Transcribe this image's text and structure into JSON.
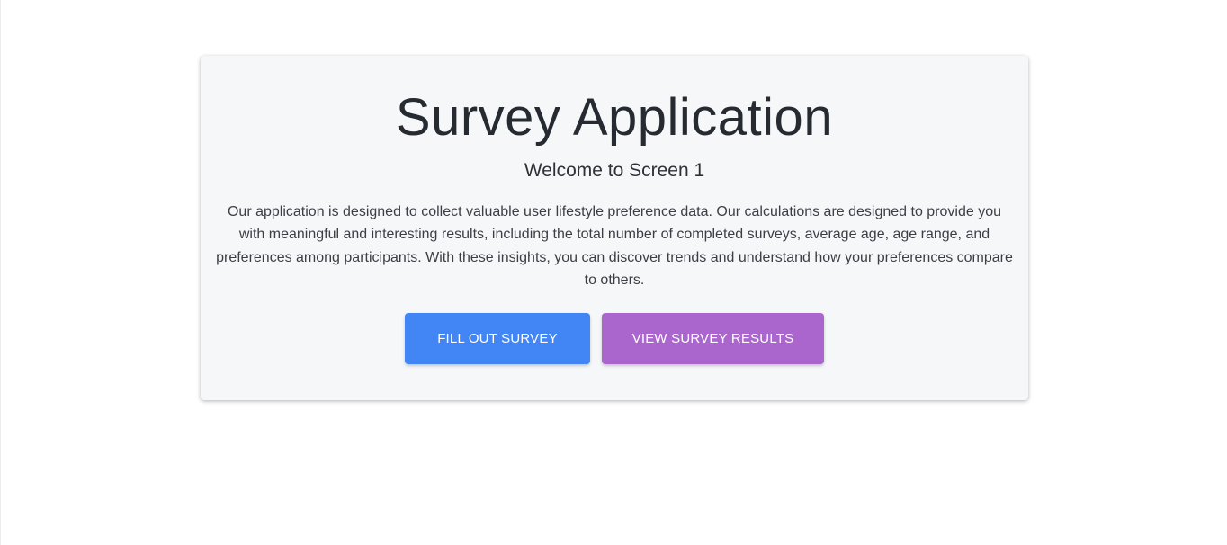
{
  "app": {
    "title": "Survey Application",
    "subtitle": "Welcome to Screen 1",
    "description": "Our application is designed to collect valuable user lifestyle preference data. Our calculations are designed to provide you with meaningful and interesting results, including the total number of completed surveys, average age, age range, and preferences among participants. With these insights, you can discover trends and understand how your preferences compare to others."
  },
  "actions": {
    "fill_survey_label": "FILL OUT SURVEY",
    "view_results_label": "VIEW SURVEY RESULTS"
  },
  "colors": {
    "primary": "#4285f4",
    "secondary": "#aa66cc",
    "card_background": "#f6f7f9"
  }
}
